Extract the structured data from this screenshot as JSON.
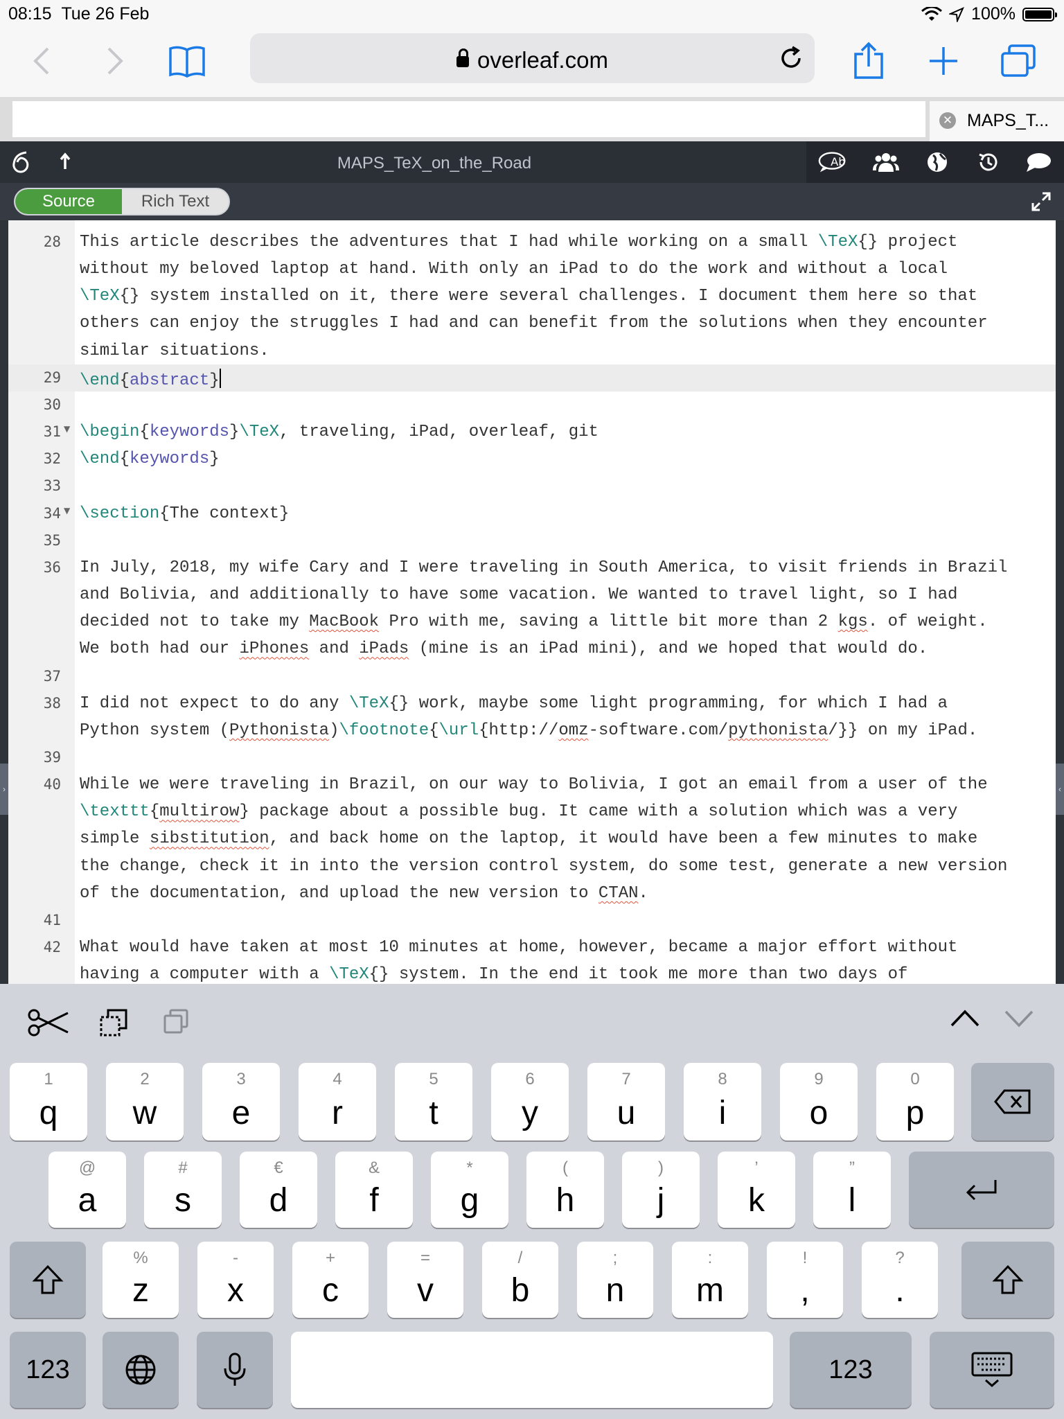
{
  "status": {
    "time": "08:15",
    "date": "Tue 26 Feb",
    "battery": "100%"
  },
  "browser": {
    "url": "overleaf.com",
    "tab_title": "MAPS_T..."
  },
  "overleaf": {
    "project_title": "MAPS_TeX_on_the_Road",
    "mode_source": "Source",
    "mode_rich": "Rich Text"
  },
  "editor": {
    "lines": [
      {
        "num": "28",
        "fold": false,
        "active": false,
        "segs": [
          [
            "t",
            "This article describes the adventures that I had while working on a small "
          ],
          [
            "c",
            "\\TeX"
          ],
          [
            "t",
            "{} project"
          ]
        ]
      },
      {
        "num": "",
        "fold": false,
        "active": false,
        "segs": [
          [
            "t",
            "without my beloved laptop at hand. With only an iPad to do the work and without a local"
          ]
        ]
      },
      {
        "num": "",
        "fold": false,
        "active": false,
        "segs": [
          [
            "c",
            "\\TeX"
          ],
          [
            "t",
            "{} system installed on it, there were several challenges. I document them here so that"
          ]
        ]
      },
      {
        "num": "",
        "fold": false,
        "active": false,
        "segs": [
          [
            "t",
            "others can enjoy the struggles I had and can benefit from the solutions when they encounter"
          ]
        ]
      },
      {
        "num": "",
        "fold": false,
        "active": false,
        "segs": [
          [
            "t",
            "similar situations."
          ]
        ]
      },
      {
        "num": "29",
        "fold": false,
        "active": true,
        "segs": [
          [
            "c",
            "\\end"
          ],
          [
            "t",
            "{"
          ],
          [
            "a",
            "abstract"
          ],
          [
            "t",
            "}"
          ],
          [
            "cursor",
            ""
          ]
        ]
      },
      {
        "num": "30",
        "fold": false,
        "active": false,
        "segs": []
      },
      {
        "num": "31",
        "fold": true,
        "active": false,
        "segs": [
          [
            "c",
            "\\begin"
          ],
          [
            "t",
            "{"
          ],
          [
            "a",
            "keywords"
          ],
          [
            "t",
            "}"
          ],
          [
            "c",
            "\\TeX"
          ],
          [
            "t",
            ", traveling, iPad, overleaf, git"
          ]
        ]
      },
      {
        "num": "32",
        "fold": false,
        "active": false,
        "segs": [
          [
            "c",
            "\\end"
          ],
          [
            "t",
            "{"
          ],
          [
            "a",
            "keywords"
          ],
          [
            "t",
            "}"
          ]
        ]
      },
      {
        "num": "33",
        "fold": false,
        "active": false,
        "segs": []
      },
      {
        "num": "34",
        "fold": true,
        "active": false,
        "segs": [
          [
            "c",
            "\\section"
          ],
          [
            "t",
            "{The context}"
          ]
        ]
      },
      {
        "num": "35",
        "fold": false,
        "active": false,
        "segs": []
      },
      {
        "num": "36",
        "fold": false,
        "active": false,
        "segs": [
          [
            "t",
            "In July, 2018, my wife Cary and I were traveling in South America, to visit friends in Brazil"
          ]
        ]
      },
      {
        "num": "",
        "fold": false,
        "active": false,
        "segs": [
          [
            "t",
            "and Bolivia, and additionally to have some vacation. We wanted to travel light, so I had"
          ]
        ]
      },
      {
        "num": "",
        "fold": false,
        "active": false,
        "segs": [
          [
            "t",
            "decided not to take my "
          ],
          [
            "s",
            "MacBook"
          ],
          [
            "t",
            " Pro with me, saving a little bit more than 2 "
          ],
          [
            "s",
            "kgs"
          ],
          [
            "t",
            ". of weight."
          ]
        ]
      },
      {
        "num": "",
        "fold": false,
        "active": false,
        "segs": [
          [
            "t",
            "We both had our "
          ],
          [
            "s",
            "iPhones"
          ],
          [
            "t",
            " and "
          ],
          [
            "s",
            "iPads"
          ],
          [
            "t",
            " (mine is an iPad mini), and we hoped that would do."
          ]
        ]
      },
      {
        "num": "37",
        "fold": false,
        "active": false,
        "segs": []
      },
      {
        "num": "38",
        "fold": false,
        "active": false,
        "segs": [
          [
            "t",
            "I did not expect to do any "
          ],
          [
            "c",
            "\\TeX"
          ],
          [
            "t",
            "{} work, maybe some light programming, for which I had a"
          ]
        ]
      },
      {
        "num": "",
        "fold": false,
        "active": false,
        "segs": [
          [
            "t",
            "Python system ("
          ],
          [
            "s",
            "Pythonista"
          ],
          [
            "t",
            ")"
          ],
          [
            "c",
            "\\footnote"
          ],
          [
            "t",
            "{"
          ],
          [
            "c",
            "\\url"
          ],
          [
            "t",
            "{http://"
          ],
          [
            "s",
            "omz"
          ],
          [
            "t",
            "-software.com/"
          ],
          [
            "s",
            "pythonista"
          ],
          [
            "t",
            "/}} on my iPad."
          ]
        ]
      },
      {
        "num": "39",
        "fold": false,
        "active": false,
        "segs": []
      },
      {
        "num": "40",
        "fold": false,
        "active": false,
        "segs": [
          [
            "t",
            "While we were traveling in Brazil, on our way to Bolivia, I got an email from a user of the"
          ]
        ]
      },
      {
        "num": "",
        "fold": false,
        "active": false,
        "segs": [
          [
            "c",
            "\\texttt"
          ],
          [
            "t",
            "{"
          ],
          [
            "s",
            "multirow"
          ],
          [
            "t",
            "} package about a possible bug. It came with a solution which was a very"
          ]
        ]
      },
      {
        "num": "",
        "fold": false,
        "active": false,
        "segs": [
          [
            "t",
            "simple "
          ],
          [
            "s",
            "sibstitution"
          ],
          [
            "t",
            ", and back home on the laptop, it would have been a few minutes to make"
          ]
        ]
      },
      {
        "num": "",
        "fold": false,
        "active": false,
        "segs": [
          [
            "t",
            "the change, check it in into the version control system, do some test, generate a new version"
          ]
        ]
      },
      {
        "num": "",
        "fold": false,
        "active": false,
        "segs": [
          [
            "t",
            "of the documentation, and upload the new version to "
          ],
          [
            "s",
            "CTAN"
          ],
          [
            "t",
            "."
          ]
        ]
      },
      {
        "num": "41",
        "fold": false,
        "active": false,
        "segs": []
      },
      {
        "num": "42",
        "fold": false,
        "active": false,
        "segs": [
          [
            "t",
            "What would have taken at most 10 minutes at home, however, became a major effort without"
          ]
        ]
      },
      {
        "num": "",
        "fold": false,
        "active": false,
        "segs": [
          [
            "t",
            "having a computer with a "
          ],
          [
            "c",
            "\\TeX"
          ],
          [
            "t",
            "{} system. In the end it took me more than two days of"
          ]
        ]
      }
    ]
  },
  "keyboard": {
    "row1": [
      [
        "1",
        "q"
      ],
      [
        "2",
        "w"
      ],
      [
        "3",
        "e"
      ],
      [
        "4",
        "r"
      ],
      [
        "5",
        "t"
      ],
      [
        "6",
        "y"
      ],
      [
        "7",
        "u"
      ],
      [
        "8",
        "i"
      ],
      [
        "9",
        "o"
      ],
      [
        "0",
        "p"
      ]
    ],
    "row2": [
      [
        "@",
        "a"
      ],
      [
        "#",
        "s"
      ],
      [
        "€",
        "d"
      ],
      [
        "&",
        "f"
      ],
      [
        "*",
        "g"
      ],
      [
        "(",
        "h"
      ],
      [
        ")",
        "j"
      ],
      [
        "’",
        "k"
      ],
      [
        "”",
        "l"
      ]
    ],
    "row3": [
      [
        "%",
        "z"
      ],
      [
        "-",
        "x"
      ],
      [
        "+",
        "c"
      ],
      [
        "=",
        "v"
      ],
      [
        "/",
        "b"
      ],
      [
        ";",
        "n"
      ],
      [
        ":",
        "m"
      ],
      [
        "!",
        ","
      ],
      [
        "?",
        "."
      ]
    ],
    "numbers_label": "123",
    "colors": {
      "background": "#d1d4da",
      "key": "#ffffff",
      "dark_key": "#acb2bc"
    }
  },
  "colors": {
    "accent_green": "#4b9c3f",
    "command": "#22877a",
    "argument": "#5555b0",
    "spell": "#e2533a"
  }
}
